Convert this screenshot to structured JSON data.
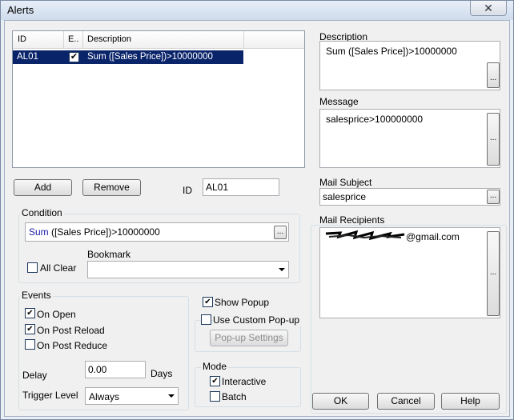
{
  "window": {
    "title": "Alerts",
    "close_glyph": "✕"
  },
  "alerts_list": {
    "columns": [
      "ID",
      "E..",
      "Description"
    ],
    "rows": [
      {
        "id": "AL01",
        "enabled": true,
        "description": "Sum ([Sales Price])>10000000"
      }
    ]
  },
  "buttons": {
    "add": "Add",
    "remove": "Remove",
    "popup_settings": "Pop-up Settings",
    "ok": "OK",
    "cancel": "Cancel",
    "help": "Help",
    "ellipsis": "..."
  },
  "id_field": {
    "label": "ID",
    "value": "AL01"
  },
  "condition": {
    "group_label": "Condition",
    "expression_func": "Sum",
    "expression_rest": " ([Sales Price])>10000000",
    "all_clear_label": "All Clear",
    "bookmark_label": "Bookmark",
    "bookmark_value": ""
  },
  "events": {
    "group_label": "Events",
    "on_open": "On Open",
    "on_post_reload": "On Post Reload",
    "on_post_reduce": "On Post Reduce",
    "delay_label": "Delay",
    "delay_value": "0.00",
    "days_label": "Days",
    "trigger_label": "Trigger Level",
    "trigger_value": "Always"
  },
  "popup": {
    "show_popup": "Show Popup",
    "use_custom": "Use Custom Pop-up"
  },
  "mode": {
    "group_label": "Mode",
    "interactive": "Interactive",
    "batch": "Batch"
  },
  "right_panel": {
    "description_label": "Description",
    "description_value": "Sum ([Sales Price])>10000000",
    "message_label": "Message",
    "message_value": "salesprice>100000000",
    "mail_subject_label": "Mail Subject",
    "mail_subject_value": "salesprice",
    "mail_recipients_label": "Mail Recipients",
    "mail_recipients_suffix": "@gmail.com"
  },
  "colors": {
    "selection": "#0a246a",
    "link_blue": "#1a1aa8",
    "window_frame": "#e9eef5"
  }
}
